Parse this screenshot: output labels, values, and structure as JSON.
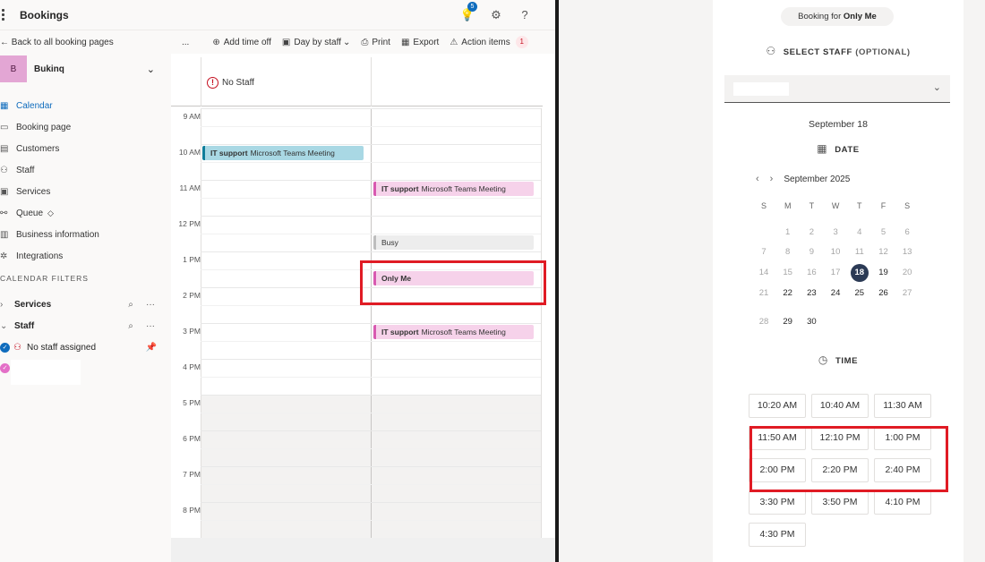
{
  "app": {
    "title": "Bookings",
    "notification_count": "5"
  },
  "sidebar": {
    "back_label": "Back to all booking pages",
    "business": {
      "initial": "B",
      "name": "Bukinq"
    },
    "items": [
      {
        "label": "Calendar",
        "icon": "calendar-icon",
        "active": true
      },
      {
        "label": "Booking page",
        "icon": "monitor-icon"
      },
      {
        "label": "Customers",
        "icon": "people-card-icon"
      },
      {
        "label": "Staff",
        "icon": "people-icon"
      },
      {
        "label": "Services",
        "icon": "briefcase-icon"
      },
      {
        "label": "Queue",
        "icon": "queue-icon"
      },
      {
        "label": "Business information",
        "icon": "building-icon"
      },
      {
        "label": "Integrations",
        "icon": "integrations-icon"
      }
    ],
    "filters_header": "CALENDAR FILTERS",
    "filters": {
      "services": "Services",
      "staff": "Staff"
    },
    "staff_list": [
      {
        "label": "No staff assigned"
      }
    ]
  },
  "toolbar": {
    "more": "...",
    "add_time_off": "Add time off",
    "view": "Day by staff",
    "print": "Print",
    "export": "Export",
    "action_items": "Action items",
    "action_count": "1"
  },
  "calendar": {
    "columns": {
      "no_staff": "No Staff"
    },
    "hours": [
      "9 AM",
      "10 AM",
      "11 AM",
      "12 PM",
      "1 PM",
      "2 PM",
      "3 PM",
      "4 PM",
      "5 PM",
      "6 PM",
      "7 PM",
      "8 PM"
    ],
    "events": [
      {
        "title": "IT support",
        "detail": "Microsoft Teams Meeting"
      },
      {
        "title": "IT support",
        "detail": "Microsoft Teams Meeting"
      },
      {
        "title": "Busy",
        "detail": ""
      },
      {
        "title": "Only Me",
        "detail": ""
      },
      {
        "title": "IT support",
        "detail": "Microsoft Teams Meeting"
      }
    ]
  },
  "booking": {
    "pill_prefix": "Booking for",
    "pill_name": "Only Me",
    "select_staff_label": "SELECT STAFF",
    "optional_label": "(OPTIONAL)",
    "selected_date": "September 18",
    "date_label": "DATE",
    "month_label": "September 2025",
    "weekdays": [
      "S",
      "M",
      "T",
      "W",
      "T",
      "F",
      "S"
    ],
    "selected_day": "18",
    "time_label": "TIME",
    "time_slots": [
      "10:20 AM",
      "10:40 AM",
      "11:30 AM",
      "11:50 AM",
      "12:10 PM",
      "1:00 PM",
      "2:00 PM",
      "2:20 PM",
      "2:40 PM",
      "3:30 PM",
      "3:50 PM",
      "4:10 PM",
      "4:30 PM"
    ]
  },
  "colors": {
    "accent": "#0f6cbd",
    "highlight": "#e01b24",
    "event_pink": "#f6d2ea",
    "event_blue": "#a9d8e4",
    "selected_day": "#2b3a55"
  }
}
